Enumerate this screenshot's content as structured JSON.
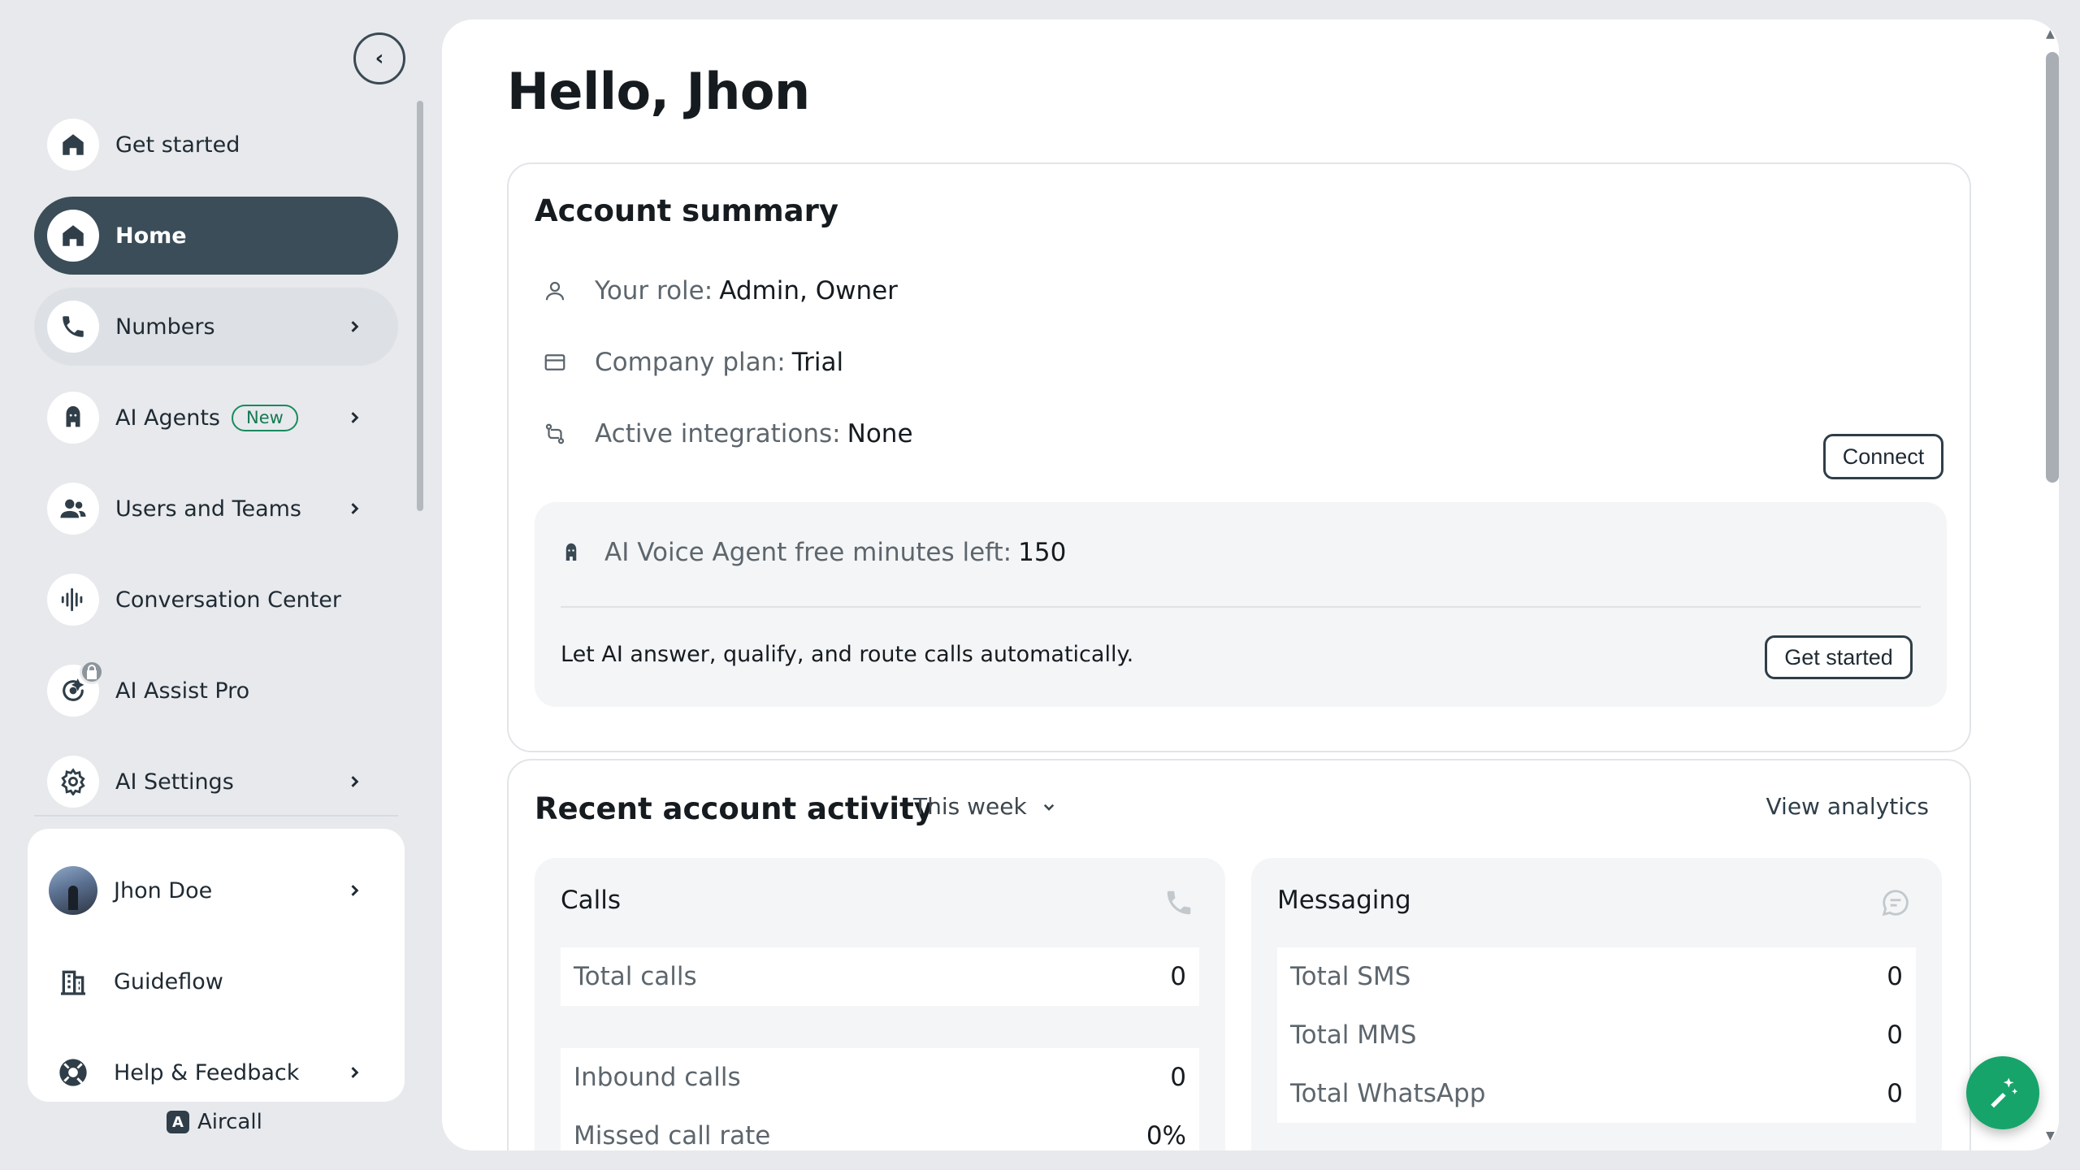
{
  "sidebar": {
    "items": [
      {
        "label": "Get started",
        "icon": "home-icon"
      },
      {
        "label": "Home",
        "icon": "home-icon"
      },
      {
        "label": "Numbers",
        "icon": "phone-icon"
      },
      {
        "label": "AI Agents",
        "badge": "New",
        "icon": "ai-agent-icon"
      },
      {
        "label": "Users and Teams",
        "icon": "users-icon"
      },
      {
        "label": "Conversation Center",
        "icon": "waveform-icon"
      },
      {
        "label": "AI Assist Pro",
        "icon": "ai-assist-icon"
      },
      {
        "label": "AI Settings",
        "icon": "gear-icon"
      }
    ],
    "bottom": [
      {
        "label": "Jhon Doe",
        "icon": "avatar"
      },
      {
        "label": "Guideflow",
        "icon": "building-icon"
      },
      {
        "label": "Help & Feedback",
        "icon": "lifebuoy-icon"
      }
    ],
    "brand": "Aircall"
  },
  "main": {
    "greeting": "Hello, Jhon",
    "account_summary": {
      "title": "Account summary",
      "role_label": "Your role:",
      "role_value": "Admin, Owner",
      "plan_label": "Company plan:",
      "plan_value": "Trial",
      "integrations_label": "Active integrations:",
      "integrations_value": "None",
      "connect_button": "Connect",
      "ai_minutes_label": "AI Voice Agent free minutes left:",
      "ai_minutes_value": "150",
      "ai_promo": "Let AI answer, qualify, and route calls automatically.",
      "get_started_button": "Get started"
    },
    "activity": {
      "title": "Recent account activity",
      "period": "This week",
      "view_analytics": "View analytics",
      "calls": {
        "title": "Calls",
        "total_label": "Total calls",
        "total_value": "0",
        "inbound_label": "Inbound calls",
        "inbound_value": "0",
        "missed_label": "Missed call rate",
        "missed_value": "0%"
      },
      "messaging": {
        "title": "Messaging",
        "sms_label": "Total SMS",
        "sms_value": "0",
        "mms_label": "Total MMS",
        "mms_value": "0",
        "whatsapp_label": "Total WhatsApp",
        "whatsapp_value": "0"
      }
    }
  },
  "colors": {
    "active_nav": "#3a4d58",
    "accent_green": "#16a46b",
    "background": "#e7e9ec"
  }
}
